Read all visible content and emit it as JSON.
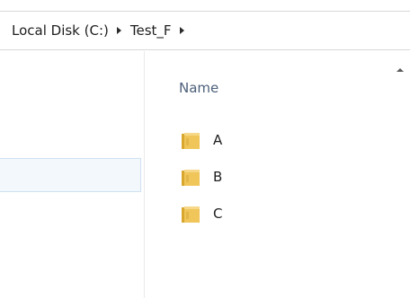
{
  "breadcrumb": {
    "items": [
      {
        "label": "Local Disk (C:)"
      },
      {
        "label": "Test_F"
      }
    ]
  },
  "content": {
    "column_header": "Name",
    "items": [
      {
        "name": "A",
        "icon": "folder-icon"
      },
      {
        "name": "B",
        "icon": "folder-icon"
      },
      {
        "name": "C",
        "icon": "folder-icon"
      }
    ]
  },
  "colors": {
    "folder_front": "#f0c65a",
    "folder_back": "#d9a62e",
    "header_text": "#4c607a",
    "selection_bg": "#f3f8fc",
    "selection_border": "#cfe1f1"
  }
}
